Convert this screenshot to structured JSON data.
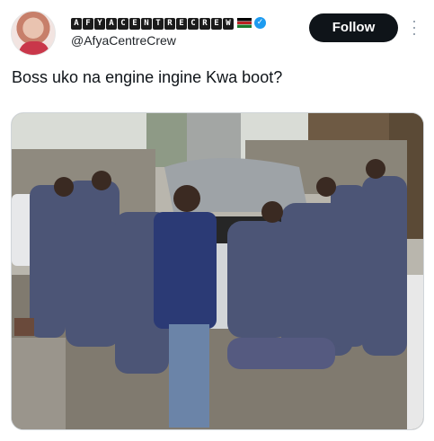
{
  "author": {
    "display_name_letters": [
      "A",
      "F",
      "Y",
      "A",
      "C",
      "E",
      "N",
      "T",
      "R",
      "E",
      "C",
      "R",
      "E",
      "W"
    ],
    "handle": "@AfyaCentreCrew",
    "verified_icon": "verified-badge-icon",
    "flag_icon": "kenya-flag-icon"
  },
  "follow_button": {
    "label": "Follow"
  },
  "more_icon": "more-dots-icon",
  "tweet": {
    "text": "Boss uko na engine ingine Kwa boot?"
  },
  "media": {
    "description_icon": "photo"
  }
}
